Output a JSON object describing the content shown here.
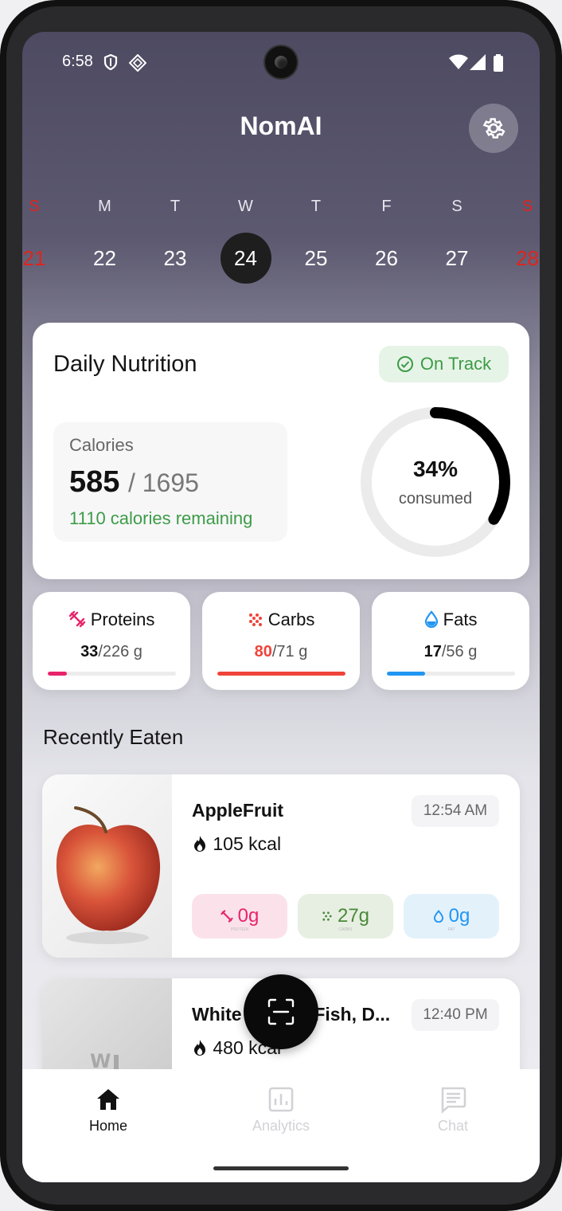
{
  "status": {
    "time": "6:58"
  },
  "header": {
    "title": "NomAI"
  },
  "week": [
    {
      "name": "S",
      "date": "21",
      "weekend": true
    },
    {
      "name": "M",
      "date": "22"
    },
    {
      "name": "T",
      "date": "23"
    },
    {
      "name": "W",
      "date": "24",
      "selected": true
    },
    {
      "name": "T",
      "date": "25"
    },
    {
      "name": "F",
      "date": "26"
    },
    {
      "name": "S",
      "date": "27"
    },
    {
      "name": "S",
      "date": "28",
      "weekend": true
    }
  ],
  "nutrition": {
    "title": "Daily Nutrition",
    "badge": "On Track",
    "calories_label": "Calories",
    "consumed": "585",
    "total": "/ 1695",
    "remaining": "1110 calories remaining",
    "percent": "34%",
    "percent_value": 0.34,
    "percent_label": "consumed"
  },
  "macros": {
    "proteins": {
      "label": "Proteins",
      "value": "33",
      "goal": "/226 g",
      "fill": 0.146,
      "color": "#e8246b"
    },
    "carbs": {
      "label": "Carbs",
      "value": "80",
      "goal": "/71 g",
      "fill": 1.0,
      "color": "#f0433a"
    },
    "fats": {
      "label": "Fats",
      "value": "17",
      "goal": "/56 g",
      "fill": 0.3,
      "color": "#2196f3"
    }
  },
  "recent": {
    "title": "Recently Eaten",
    "items": [
      {
        "name": "AppleFruit",
        "kcal": "105 kcal",
        "time": "12:54 AM",
        "protein": "0g",
        "carbs": "27g",
        "fat": "0g",
        "protein_sub": "PROTEIN",
        "carbs_sub": "CARBS",
        "fat_sub": "FAT"
      },
      {
        "name": "White Coated Fish, D...",
        "kcal": "480 kcal",
        "time": "12:40 PM"
      }
    ]
  },
  "nav": {
    "home": "Home",
    "analytics": "Analytics",
    "chat": "Chat"
  }
}
